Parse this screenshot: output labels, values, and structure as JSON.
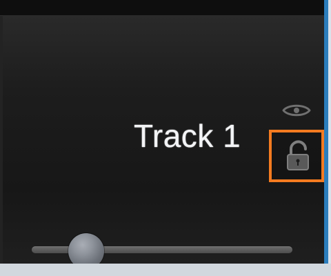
{
  "track": {
    "name": "Track 1",
    "visibility_icon": "eye-icon",
    "lock_icon": "lock-open-icon",
    "lock_state": "unlocked"
  },
  "controls": {
    "volume_level": 0.21
  },
  "colors": {
    "highlight": "#f47b20",
    "panel_background": "#1f1f1f",
    "text": "#f3f4f6"
  }
}
